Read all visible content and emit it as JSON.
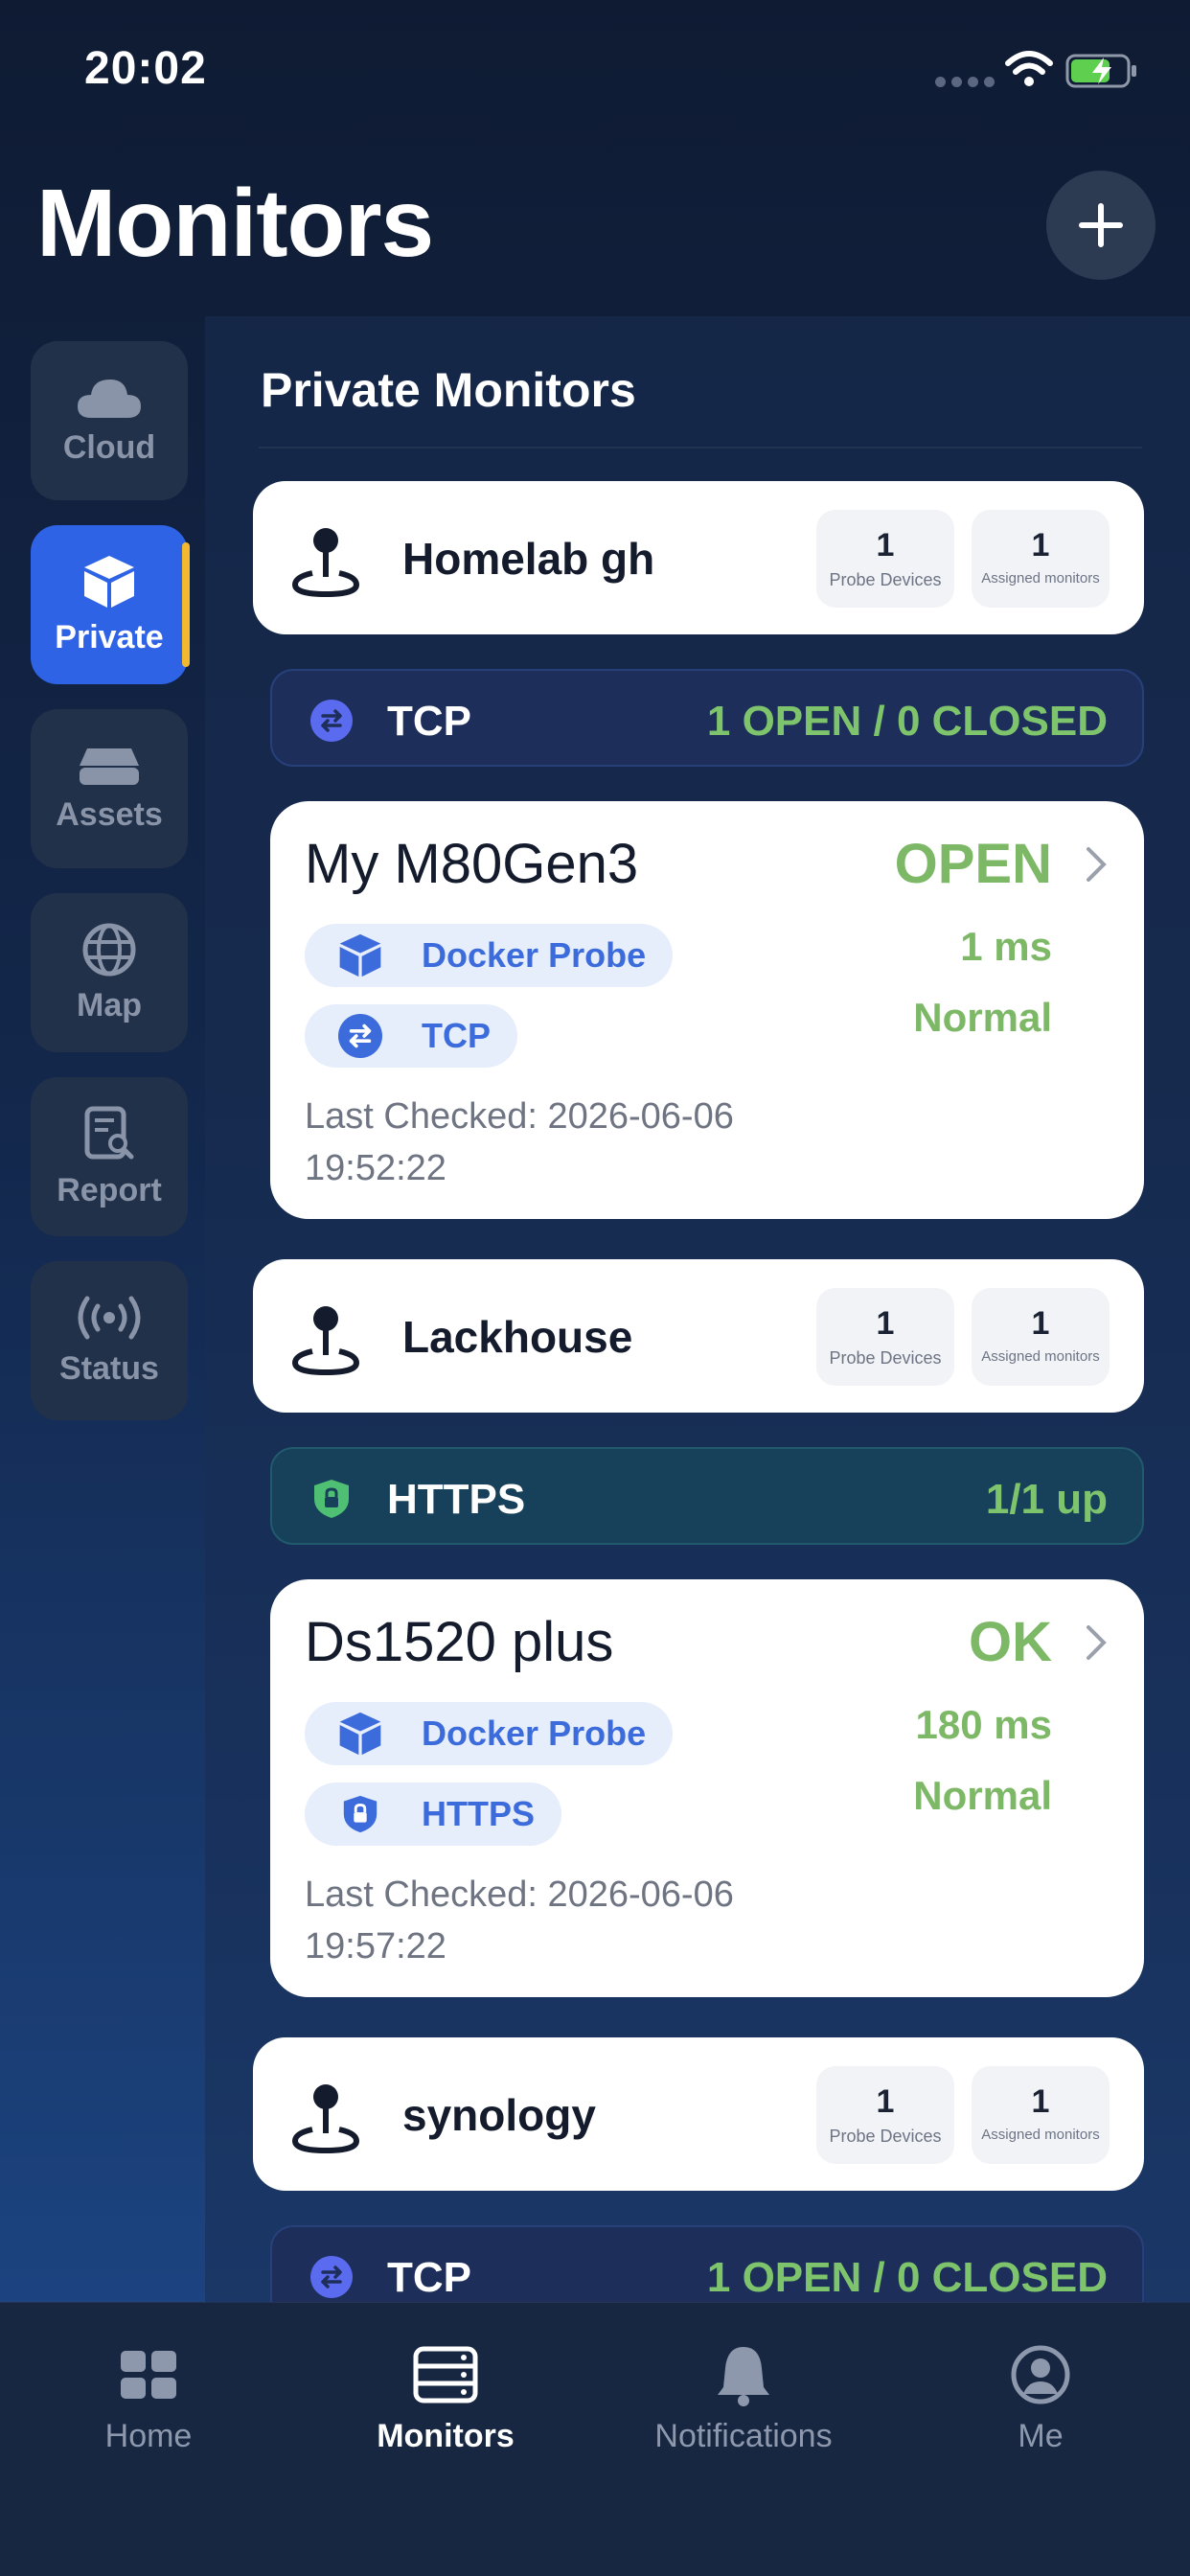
{
  "status_bar": {
    "time": "20:02"
  },
  "header": {
    "title": "Monitors"
  },
  "sidebar": {
    "items": [
      {
        "label": "Cloud",
        "icon": "cloud-icon",
        "active": false
      },
      {
        "label": "Private",
        "icon": "box-icon",
        "active": true
      },
      {
        "label": "Assets",
        "icon": "server-icon",
        "active": false
      },
      {
        "label": "Map",
        "icon": "globe-icon",
        "active": false
      },
      {
        "label": "Report",
        "icon": "report-icon",
        "active": false
      },
      {
        "label": "Status",
        "icon": "broadcast-icon",
        "active": false
      }
    ]
  },
  "main": {
    "section_title": "Private Monitors",
    "groups": [
      {
        "name": "Homelab gh",
        "probe_devices": "1",
        "probe_devices_label": "Probe Devices",
        "assigned_monitors": "1",
        "assigned_monitors_label": "Assigned monitors",
        "protocol": {
          "name": "TCP",
          "summary": "1 OPEN / 0 CLOSED"
        },
        "monitor": {
          "name": "My M80Gen3",
          "state": "OPEN",
          "latency": "1 ms",
          "health": "Normal",
          "probe_tag": "Docker Probe",
          "protocol_tag": "TCP",
          "last_checked": "Last Checked: 2026-06-06 19:52:22"
        }
      },
      {
        "name": "Lackhouse",
        "probe_devices": "1",
        "probe_devices_label": "Probe Devices",
        "assigned_monitors": "1",
        "assigned_monitors_label": "Assigned monitors",
        "protocol": {
          "name": "HTTPS",
          "summary": "1/1 up"
        },
        "monitor": {
          "name": "Ds1520 plus",
          "state": "OK",
          "latency": "180 ms",
          "health": "Normal",
          "probe_tag": "Docker Probe",
          "protocol_tag": "HTTPS",
          "last_checked": "Last Checked: 2026-06-06 19:57:22"
        }
      },
      {
        "name": "synology",
        "probe_devices": "1",
        "probe_devices_label": "Probe Devices",
        "assigned_monitors": "1",
        "assigned_monitors_label": "Assigned monitors",
        "protocol": {
          "name": "TCP",
          "summary": "1 OPEN / 0 CLOSED"
        }
      }
    ]
  },
  "tab_bar": {
    "items": [
      {
        "label": "Home",
        "icon": "grid-icon",
        "active": false
      },
      {
        "label": "Monitors",
        "icon": "server-rack-icon",
        "active": true
      },
      {
        "label": "Notifications",
        "icon": "bell-icon",
        "active": false
      },
      {
        "label": "Me",
        "icon": "profile-icon",
        "active": false
      }
    ]
  },
  "colors": {
    "accent": "#2f63e6",
    "active_indicator": "#f2b930",
    "status_ok": "#7cb866",
    "tag_text": "#3c6bdc"
  }
}
